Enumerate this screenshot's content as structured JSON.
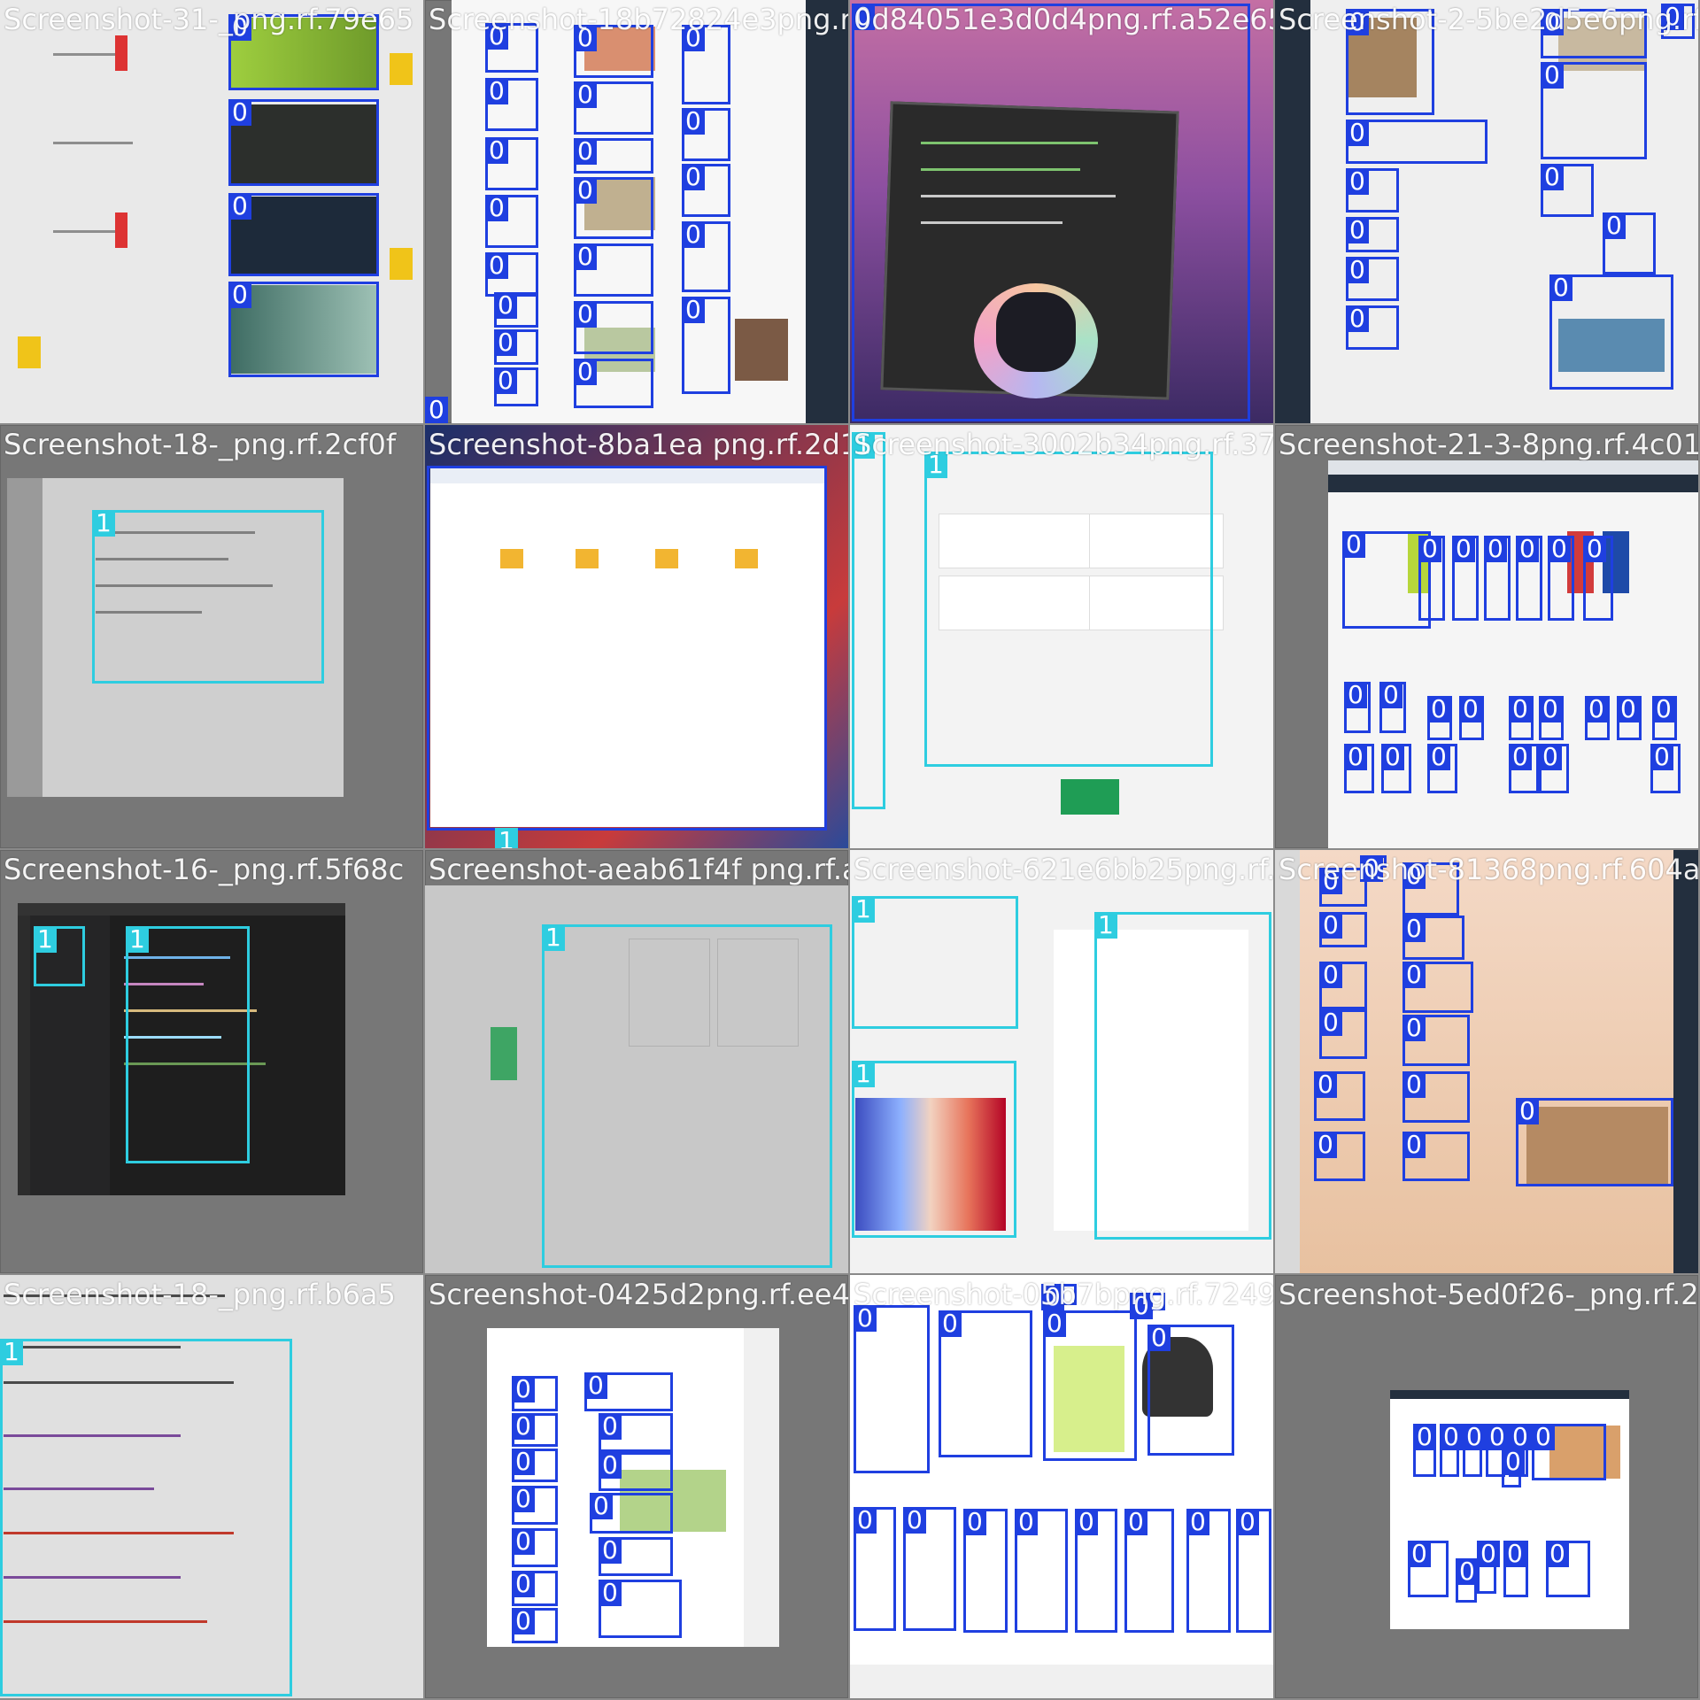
{
  "colors": {
    "class_0": "#1f3fe0",
    "class_1": "#2ecde0"
  },
  "tiles": [
    {
      "title": "Screenshot-31-_png.rf.79e65",
      "labels": [
        "0",
        "0",
        "0",
        "0"
      ]
    },
    {
      "title": "Screenshot-18b72824e3png.rf.2191",
      "labels": [
        "0",
        "0",
        "0",
        "0",
        "0",
        "0",
        "0",
        "0",
        "0",
        "0",
        "0",
        "0",
        "0",
        "0",
        "0",
        "0",
        "0",
        "0",
        "0",
        "0",
        "0"
      ]
    },
    {
      "title": "0d84051e3d0d4png.rf.a52e65",
      "labels": [
        "0"
      ]
    },
    {
      "title": "Screenshot-2-5be2d5e6png.rf.e60a",
      "labels": [
        "0",
        "0",
        "0",
        "0",
        "0",
        "0",
        "0",
        "0",
        "0",
        "0",
        "0",
        "0"
      ]
    },
    {
      "title": "Screenshot-18-_png.rf.2cf0f",
      "labels": [
        "1"
      ]
    },
    {
      "title": "Screenshot-8ba1ea png.rf.2d11",
      "labels": [
        "1"
      ]
    },
    {
      "title": "Screenshot-3002b34png.rf.37ae",
      "labels": [
        "1",
        "1"
      ]
    },
    {
      "title": "Screenshot-21-3-8png.rf.4c01",
      "labels": [
        "0",
        "0",
        "0",
        "0",
        "0",
        "0",
        "0",
        "0",
        "0",
        "0",
        "0",
        "0",
        "0",
        "0",
        "0",
        "0",
        "0",
        "0",
        "0",
        "0",
        "0",
        "0"
      ]
    },
    {
      "title": "Screenshot-16-_png.rf.5f68c",
      "labels": [
        "1",
        "1"
      ]
    },
    {
      "title": "Screenshot-aeab61f4f png.rf.ad575",
      "labels": [
        "1"
      ]
    },
    {
      "title": "Screenshot-621e6bb25png.rf.b11",
      "labels": [
        "1",
        "1",
        "1"
      ]
    },
    {
      "title": "Screenshot-81368png.rf.604a",
      "labels": [
        "0",
        "0",
        "0",
        "0",
        "0",
        "0",
        "0",
        "0",
        "0",
        "0",
        "0",
        "0",
        "0",
        "0"
      ]
    },
    {
      "title": "Screenshot-18-_png.rf.b6a5",
      "labels": [
        "1"
      ]
    },
    {
      "title": "Screenshot-0425d2png.rf.ee4b",
      "labels": [
        "0",
        "0",
        "0",
        "0",
        "0",
        "0",
        "0",
        "0",
        "0",
        "0",
        "0",
        "0",
        "0"
      ]
    },
    {
      "title": "Screenshot-05b7bpng.rf.7249a",
      "labels": [
        "0",
        "0",
        "0",
        "0",
        "0",
        "0",
        "0",
        "0",
        "0",
        "0",
        "0",
        "0",
        "0",
        "0"
      ]
    },
    {
      "title": "Screenshot-5ed0f26-_png.rf.218a",
      "labels": [
        "0",
        "0",
        "0",
        "0",
        "0",
        "0",
        "0",
        "0",
        "0",
        "0",
        "0",
        "0"
      ]
    }
  ]
}
